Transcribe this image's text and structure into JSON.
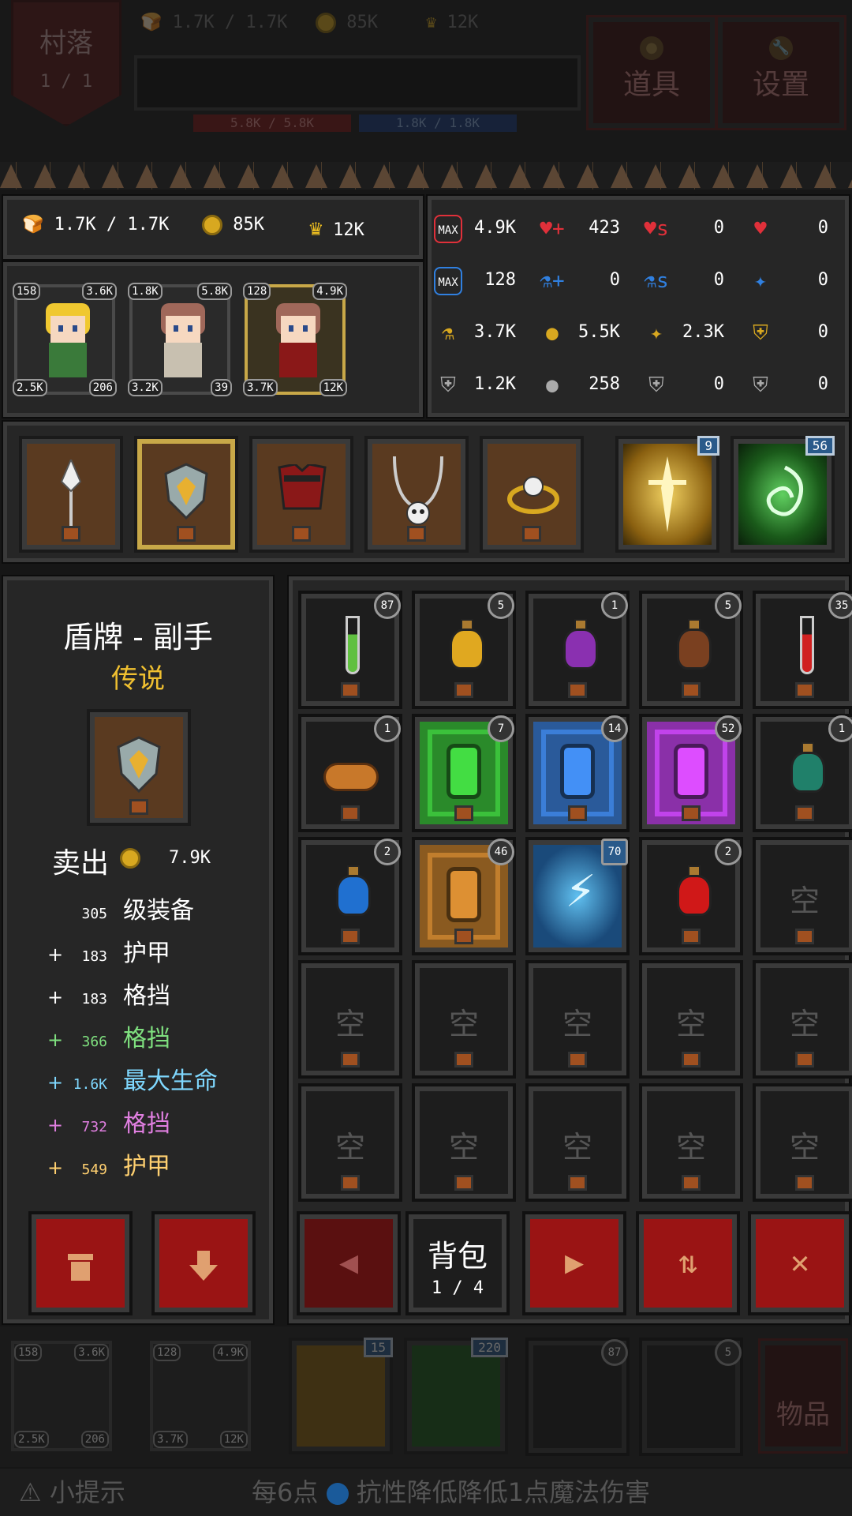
{
  "top": {
    "village_title": "村落",
    "village_count": "1 / 1",
    "food": "1.7K / 1.7K",
    "gold": "85K",
    "crown": "12K",
    "hp_red": "5.8K / 5.8K",
    "hp_blue": "1.8K / 1.8K",
    "items_label": "道具",
    "settings_label": "设置"
  },
  "resources": {
    "food": "1.7K / 1.7K",
    "gold": "85K",
    "crown": "12K"
  },
  "heroes": [
    {
      "tl": "158",
      "tr": "3.6K",
      "bl": "2.5K",
      "br": "206",
      "hair": "#f0c830",
      "robe": "#3a7a3a"
    },
    {
      "tl": "1.8K",
      "tr": "5.8K",
      "bl": "3.2K",
      "br": "39",
      "hair": "#a0685a",
      "robe": "#c8c0b0"
    },
    {
      "tl": "128",
      "tr": "4.9K",
      "bl": "3.7K",
      "br": "12K",
      "hair": "#a0685a",
      "robe": "#8a1818"
    }
  ],
  "stats": [
    [
      "MAX",
      "4.9K",
      "♥+",
      "423",
      "♥s",
      "0",
      "♥",
      "0"
    ],
    [
      "MAX",
      "128",
      "⚗+",
      "0",
      "⚗s",
      "0",
      "✦",
      "0"
    ],
    [
      "⚗",
      "3.7K",
      "●",
      "5.5K",
      "✦",
      "2.3K",
      "⛨",
      "0"
    ],
    [
      "⛨",
      "1.2K",
      "●",
      "258",
      "⛨",
      "0",
      "⛨",
      "0"
    ]
  ],
  "stat_colors": [
    "#e0303a",
    "#3080e0",
    "#d8a820",
    "#aaaaaa"
  ],
  "skills": [
    {
      "count": "9"
    },
    {
      "count": "56"
    }
  ],
  "detail": {
    "title": "盾牌 - 副手",
    "rarity": "传说",
    "sell_label": "卖出",
    "sell_price": "7.9K",
    "attrs": [
      {
        "prefix": "",
        "num": "305",
        "name": "级装备",
        "color": "#ffffff"
      },
      {
        "prefix": "+",
        "num": "183",
        "name": "护甲",
        "color": "#ffffff"
      },
      {
        "prefix": "+",
        "num": "183",
        "name": "格挡",
        "color": "#ffffff"
      },
      {
        "prefix": "+",
        "num": "366",
        "name": "格挡",
        "color": "#7fe07f"
      },
      {
        "prefix": "+",
        "num": "1.6K",
        "name": "最大生命",
        "color": "#7fd8ff"
      },
      {
        "prefix": "+",
        "num": "732",
        "name": "格挡",
        "color": "#e07fe0"
      },
      {
        "prefix": "+",
        "num": "549",
        "name": "护甲",
        "color": "#ffd070"
      }
    ]
  },
  "inventory": {
    "empty_label": "空",
    "cells": [
      {
        "kind": "tube",
        "color": "#60c040",
        "count": "87"
      },
      {
        "kind": "flask",
        "color": "#e0a820",
        "count": "5"
      },
      {
        "kind": "flask",
        "color": "#8a30b0",
        "count": "1"
      },
      {
        "kind": "flask",
        "color": "#7a4020",
        "count": "5"
      },
      {
        "kind": "tube",
        "color": "#d02020",
        "count": "35"
      },
      {
        "kind": "bread",
        "color": "#c8782a",
        "count": "1"
      },
      {
        "kind": "gem",
        "color": "#2a8a2a",
        "count": "7"
      },
      {
        "kind": "gem",
        "color": "#2a5a9a",
        "count": "14"
      },
      {
        "kind": "gem",
        "color": "#8a30a8",
        "count": "52"
      },
      {
        "kind": "flask",
        "color": "#20806a",
        "count": "1"
      },
      {
        "kind": "flask",
        "color": "#2070d0",
        "count": "2"
      },
      {
        "kind": "gem",
        "color": "#8a5a20",
        "count": "46"
      },
      {
        "kind": "scroll",
        "color": "#1a5a8a",
        "count": "70"
      },
      {
        "kind": "flask",
        "color": "#d01818",
        "count": "2"
      },
      {
        "kind": "empty"
      },
      {
        "kind": "empty"
      },
      {
        "kind": "empty"
      },
      {
        "kind": "empty"
      },
      {
        "kind": "empty"
      },
      {
        "kind": "empty"
      },
      {
        "kind": "empty"
      },
      {
        "kind": "empty"
      },
      {
        "kind": "empty"
      },
      {
        "kind": "empty"
      },
      {
        "kind": "empty"
      }
    ]
  },
  "bag": {
    "label": "背包",
    "page": "1 / 4"
  },
  "dock": {
    "h1": {
      "tl": "158",
      "tr": "3.6K",
      "bl": "2.5K",
      "br": "206"
    },
    "h2": {
      "tl": "128",
      "tr": "4.9K",
      "bl": "3.7K",
      "br": "12K"
    },
    "s1": "15",
    "s2": "220",
    "i1": "87",
    "i2": "5",
    "items_label": "物品"
  },
  "tip": {
    "label": "小提示",
    "text": "每6点",
    "text2": "抗性降低降低1点魔法伤害"
  }
}
